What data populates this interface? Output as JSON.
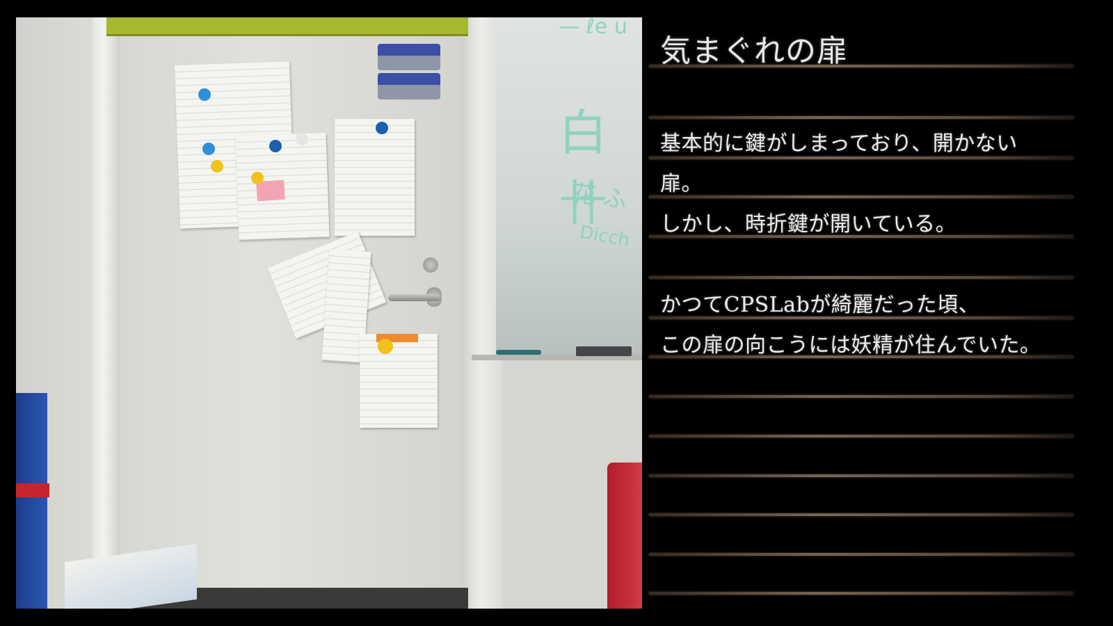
{
  "title": "気まぐれの扉",
  "body_lines": [
    "基本的に鍵がしまっており、開かない",
    "扉。",
    "しかし、時折鍵が開いている。",
    "",
    "かつてCPSLabが綺麗だった頃、",
    "この扉の向こうには妖精が住んでいた。"
  ],
  "colors": {
    "background": "#000000",
    "text": "#ececec",
    "rule": "#a08770"
  }
}
